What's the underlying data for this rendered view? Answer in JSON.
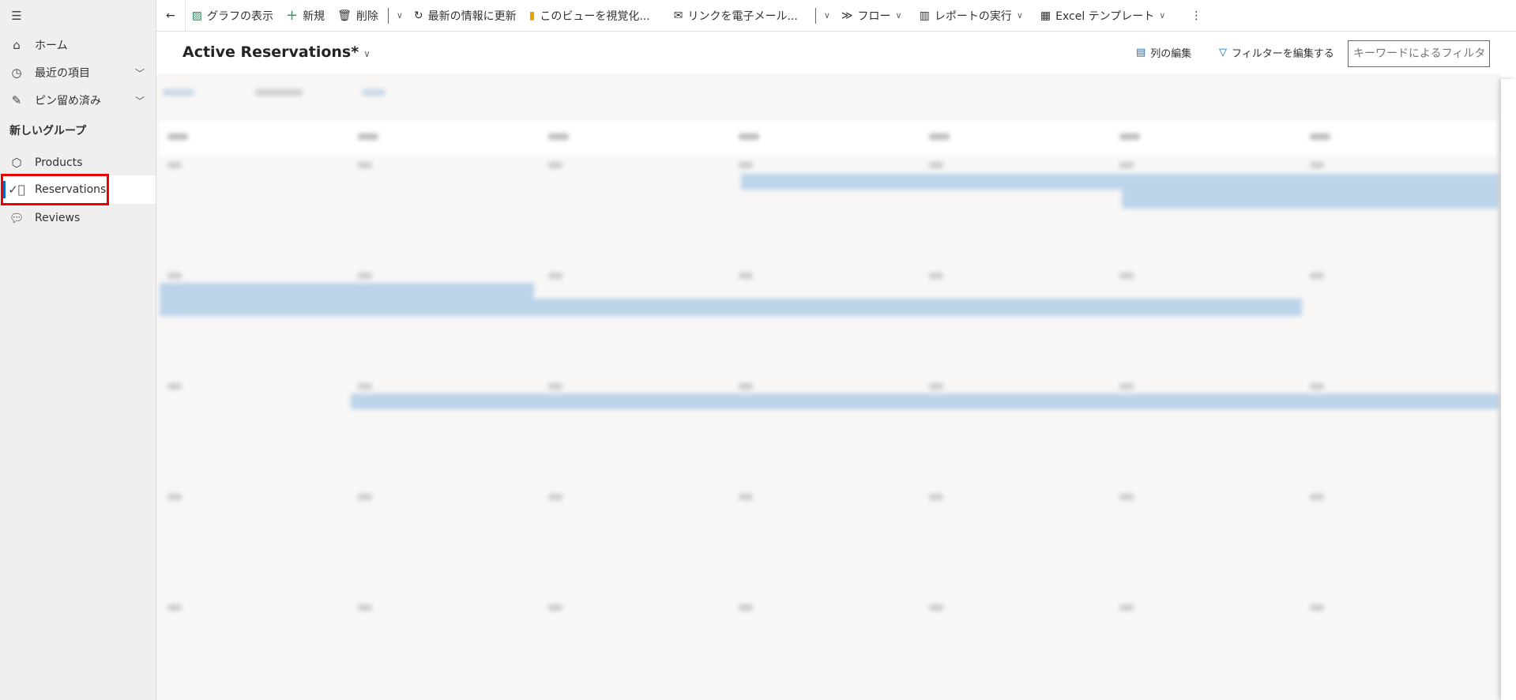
{
  "sidebar": {
    "menu_icon": "hamburger-icon",
    "items": [
      {
        "label": "ホーム",
        "icon": "home-icon"
      },
      {
        "label": "最近の項目",
        "icon": "clock-icon",
        "expandable": true
      },
      {
        "label": "ピン留め済み",
        "icon": "pin-icon",
        "expandable": true
      }
    ],
    "group_title": "新しいグループ",
    "group_items": [
      {
        "label": "Products",
        "icon": "box-icon"
      },
      {
        "label": "Reservations",
        "icon": "check-circle-icon",
        "selected": true
      },
      {
        "label": "Reviews",
        "icon": "comment-icon"
      }
    ],
    "highlight_color": "#e00000"
  },
  "toolbar": {
    "show_chart": "グラフの表示",
    "new": "新規",
    "delete": "削除",
    "refresh": "最新の情報に更新",
    "visualize": "このビューを視覚化...",
    "email_link": "リンクを電子メール...",
    "flow": "フロー",
    "run_report": "レポートの実行",
    "excel_templates": "Excel テンプレート"
  },
  "header": {
    "view_title": "Active Reservations*",
    "edit_columns": "列の編集",
    "edit_filters": "フィルターを編集する",
    "search_placeholder": "キーワードによるフィルタ"
  },
  "colors": {
    "accent": "#0f6cbd",
    "event_bar": "#bcd4ea"
  }
}
